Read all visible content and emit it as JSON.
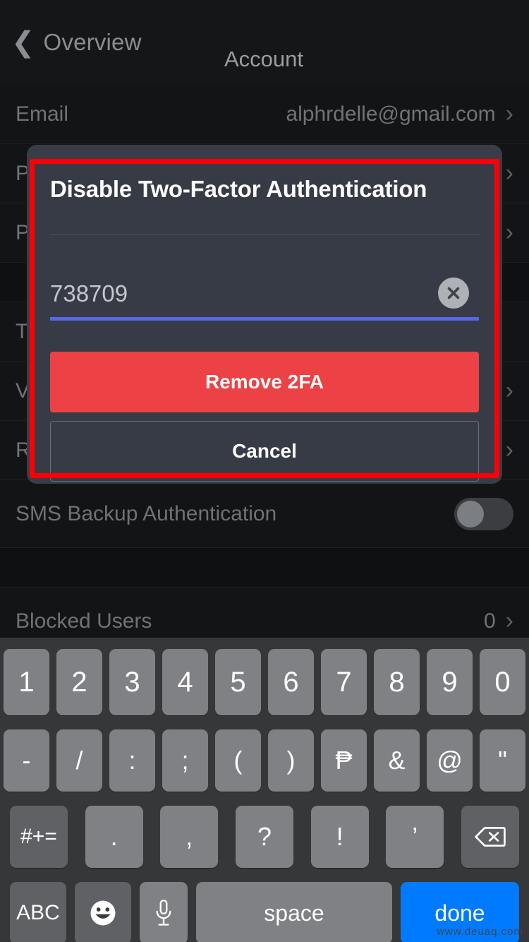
{
  "navbar": {
    "back_label": "Overview",
    "back_icon": "chevron-left-icon",
    "title": "Account"
  },
  "settings_rows": [
    {
      "label": "Email",
      "value": "alphrdelle@gmail.com",
      "chevron": "›"
    },
    {
      "label": "Phone Number",
      "value": "",
      "chevron": "›"
    },
    {
      "label": "Password",
      "value": "",
      "chevron": "›"
    },
    {
      "label": "Two-Factor Authentication",
      "value": "",
      "chevron": ""
    },
    {
      "label": "View Backup Codes",
      "value": "",
      "chevron": "›"
    },
    {
      "label": "Register Security Key",
      "value": "",
      "chevron": "›"
    },
    {
      "label": "SMS Backup Authentication",
      "value": "",
      "chevron": ""
    },
    {
      "label": "Blocked Users",
      "value": "0",
      "chevron": "›"
    }
  ],
  "modal": {
    "title": "Disable Two-Factor Authentication",
    "code_value": "738709",
    "clear_icon": "clear-circle-x-icon",
    "remove_label": "Remove 2FA",
    "cancel_label": "Cancel",
    "accent_underline_color": "#5865F2",
    "danger_color": "#ED4245",
    "highlight_border_color": "#FB0007"
  },
  "keyboard": {
    "row1": [
      "1",
      "2",
      "3",
      "4",
      "5",
      "6",
      "7",
      "8",
      "9",
      "0"
    ],
    "row2": [
      "-",
      "/",
      ":",
      ";",
      "(",
      ")",
      "₱",
      "&",
      "@",
      "\""
    ],
    "row3": [
      "#+=",
      ".",
      ",",
      "?",
      "!",
      "’"
    ],
    "row3_backspace_icon": "backspace-icon",
    "row4": {
      "abc_label": "ABC",
      "emoji_icon": "emoji-smiley-icon",
      "mic_icon": "microphone-icon",
      "space_label": "space",
      "done_label": "done",
      "done_color": "#007AFF"
    }
  },
  "watermark": "www.deuaq.com"
}
